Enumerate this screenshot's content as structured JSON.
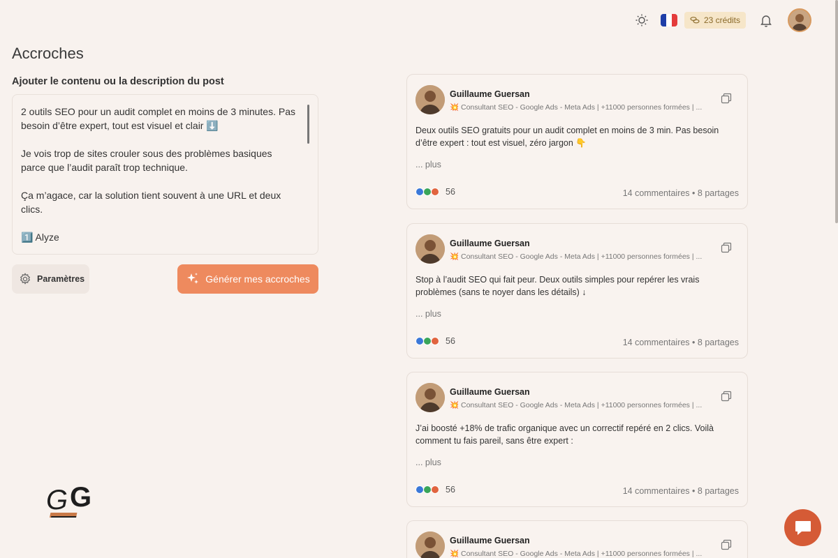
{
  "header": {
    "credits_label": "23 crédits",
    "flag_colors": [
      "#1f3ea8",
      "#ffffff",
      "#e43b3b"
    ]
  },
  "main": {
    "title": "Accroches",
    "content_label": "Ajouter le contenu ou la description du post",
    "editor_paragraphs": [
      "2 outils SEO pour un audit complet en moins de 3 minutes. Pas besoin d’être expert, tout est visuel et clair ⬇️",
      "Je vois trop de sites crouler sous des problèmes basiques parce que l’audit paraît trop technique.",
      "Ça m’agace, car la solution tient souvent à une URL et deux clics.",
      "1️⃣ Alyze"
    ],
    "params_label": "Paramètres",
    "generate_label": "Générer mes accroches"
  },
  "posts": [
    {
      "author": "Guillaume Guersan",
      "headline": "💥 Consultant SEO - Google Ads - Meta Ads | +11000 personnes formées | ...",
      "body": "Deux outils SEO gratuits pour un audit complet en moins de 3 min. Pas besoin d’être expert : tout est visuel, zéro jargon 👇",
      "more": "... plus",
      "reactions": "56",
      "comments": "14 commentaires",
      "shares": "8 partages"
    },
    {
      "author": "Guillaume Guersan",
      "headline": "💥 Consultant SEO - Google Ads - Meta Ads | +11000 personnes formées | ...",
      "body": "Stop à l’audit SEO qui fait peur. Deux outils simples pour repérer les vrais problèmes (sans te noyer dans les détails) ↓",
      "more": "... plus",
      "reactions": "56",
      "comments": "14 commentaires",
      "shares": "8 partages"
    },
    {
      "author": "Guillaume Guersan",
      "headline": "💥 Consultant SEO - Google Ads - Meta Ads | +11000 personnes formées | ...",
      "body": "J’ai boosté +18% de trafic organique avec un correctif repéré en 2 clics. Voilà comment tu fais pareil, sans être expert :",
      "more": "... plus",
      "reactions": "56",
      "comments": "14 commentaires",
      "shares": "8 partages"
    },
    {
      "author": "Guillaume Guersan",
      "headline": "💥 Consultant SEO - Google Ads - Meta Ads | +11000 personnes formées | ...",
      "body": "",
      "more": "",
      "reactions": "",
      "comments": "",
      "shares": ""
    }
  ],
  "separator": "•",
  "colors": {
    "accent": "#ee8a5e",
    "chat": "#d55b36",
    "background": "#f8f2ee"
  }
}
